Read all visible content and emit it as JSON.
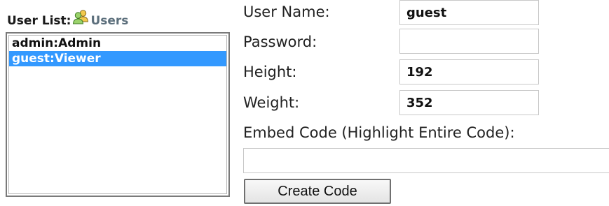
{
  "user_list": {
    "label": "User List:",
    "users_link": "Users",
    "icon": "users-icon",
    "options": [
      {
        "label": "admin:Admin",
        "selected": false
      },
      {
        "label": "guest:Viewer",
        "selected": true
      }
    ]
  },
  "form": {
    "username": {
      "label": "User Name:",
      "value": "guest"
    },
    "password": {
      "label": "Password:",
      "value": ""
    },
    "height": {
      "label": "Height:",
      "value": "192"
    },
    "weight": {
      "label": "Weight:",
      "value": "352"
    },
    "embed_code": {
      "label": "Embed Code (Highlight Entire Code):",
      "value": ""
    },
    "create_button": "Create Code"
  },
  "colors": {
    "selection": "#3399ff",
    "users_link": "#5c6f7c"
  }
}
